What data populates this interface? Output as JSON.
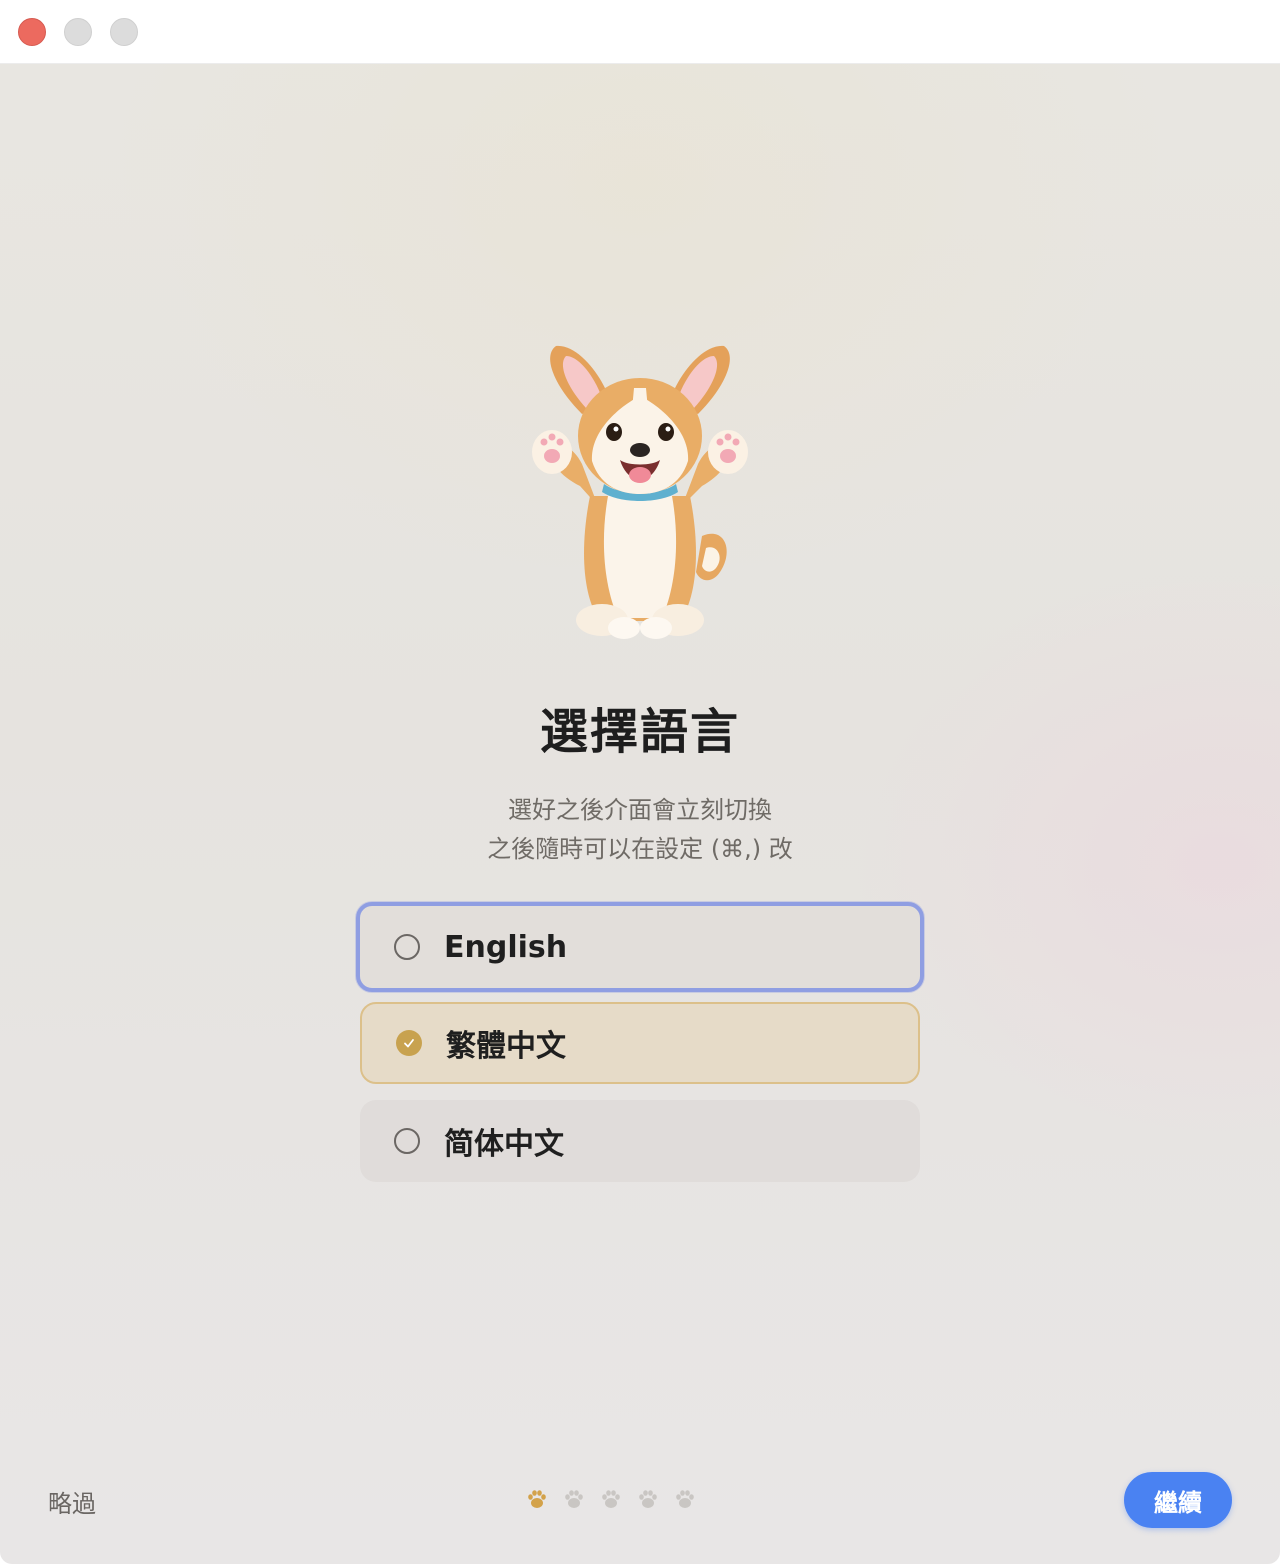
{
  "window": {
    "controls": [
      "close",
      "minimize",
      "zoom"
    ]
  },
  "onboarding": {
    "title": "選擇語言",
    "subtitle_line1": "選好之後介面會立刻切換",
    "subtitle_line2": "之後隨時可以在設定 (⌘,) 改",
    "mascot_icon": "corgi-mascot-icon"
  },
  "languages": [
    {
      "label": "English",
      "selected": false,
      "focused": true
    },
    {
      "label": "繁體中文",
      "selected": true,
      "focused": false
    },
    {
      "label": "简体中文",
      "selected": false,
      "focused": false
    }
  ],
  "footer": {
    "skip_label": "略過",
    "continue_label": "繼續",
    "step_current": 1,
    "step_total": 5,
    "step_icon": "paw-icon"
  },
  "colors": {
    "accent_blue": "#4a82f2",
    "focus_ring": "#8f9ee2",
    "selected_gold": "#c8a24f",
    "selected_bg": "#e6dbc8",
    "close_red": "#ec6a5f"
  }
}
